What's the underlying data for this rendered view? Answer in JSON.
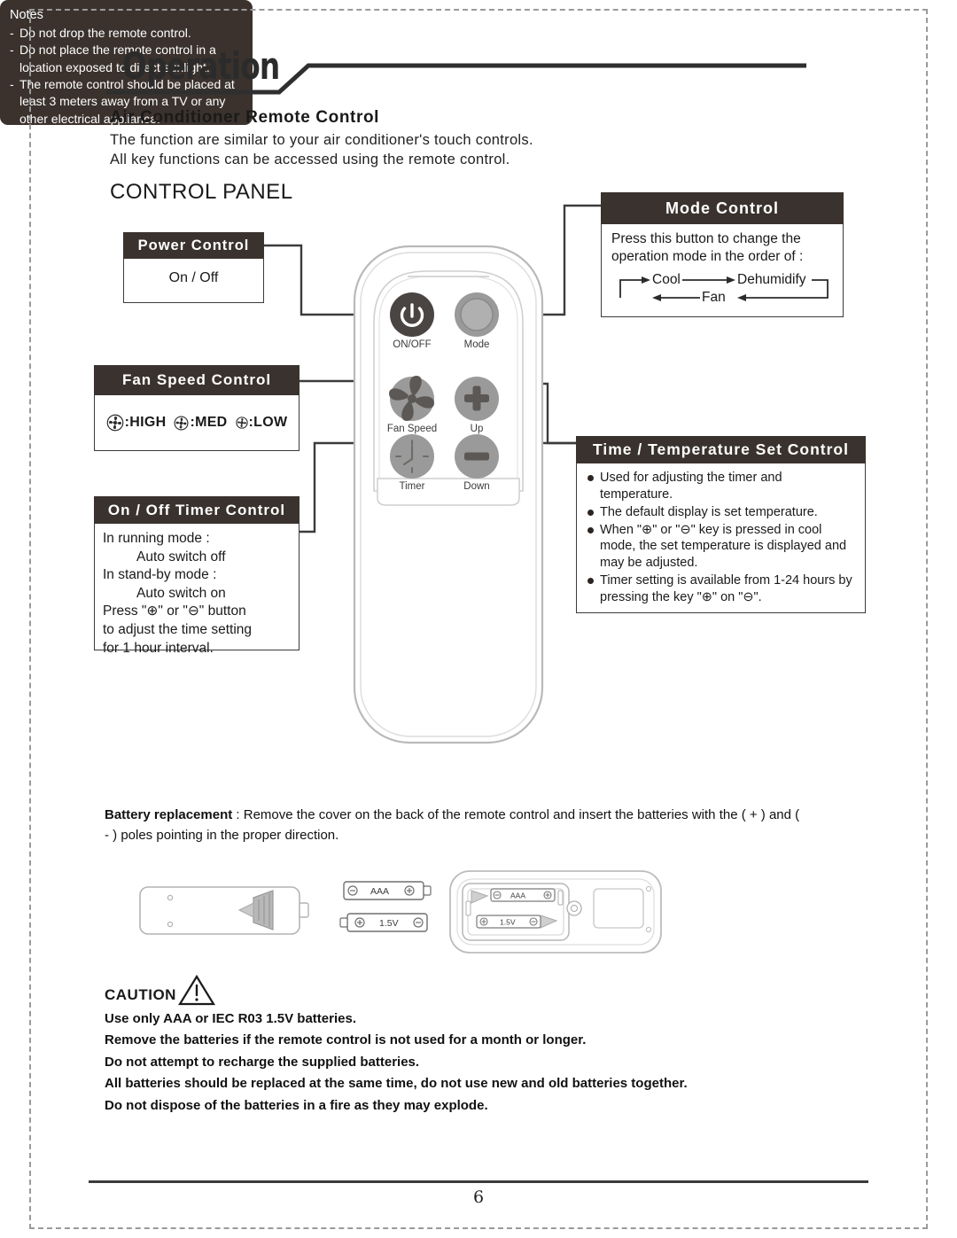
{
  "page": {
    "section_title": "Operation",
    "number": "6"
  },
  "intro": {
    "heading": "Air Conditioner Remote Control",
    "line1": "The function are similar to your air conditioner's touch controls.",
    "line2": "All key functions can be accessed using the remote control.",
    "panel_title": "CONTROL PANEL"
  },
  "callouts": {
    "power": {
      "title": "Power Control",
      "body": "On / Off"
    },
    "fan_speed": {
      "title": "Fan Speed Control",
      "options": [
        {
          "icon": "fan-icon-high",
          "label": ":HIGH"
        },
        {
          "icon": "fan-icon-med",
          "label": ":MED"
        },
        {
          "icon": "fan-icon-low",
          "label": ":LOW"
        }
      ]
    },
    "timer": {
      "title": "On / Off Timer Control",
      "lines": [
        "In running mode :",
        "Auto switch off",
        "In stand-by mode :",
        "Auto switch on",
        "Press \"⊕\" or \"⊖\" button",
        "to adjust the time setting",
        "for 1 hour interval."
      ]
    },
    "notes": {
      "title": "Notes",
      "items": [
        "Do not drop the remote control.",
        "Do not place the remote control in a location exposed to direct sunlight.",
        "The remote control should be placed at least 3 meters away from a TV or any other electrical appliance."
      ]
    },
    "mode": {
      "title": "Mode Control",
      "line1": "Press this button to change the",
      "line2": "operation mode in the order of :",
      "cycle": [
        "Cool",
        "Dehumidify",
        "Fan"
      ]
    },
    "time_temp": {
      "title": "Time / Temperature Set Control",
      "bullets": [
        "Used for adjusting the timer and temperature.",
        "The default display is set temperature.",
        "When \"⊕\" or \"⊖\" key is pressed in cool mode, the set temperature is displayed and may be adjusted.",
        "Timer setting is available from 1-24 hours by pressing the key \"⊕\" on \"⊖\"."
      ]
    }
  },
  "remote": {
    "buttons": [
      {
        "name": "on-off-button",
        "label": "ON/OFF",
        "icon": "power-icon"
      },
      {
        "name": "mode-button",
        "label": "Mode",
        "icon": "ring-icon"
      },
      {
        "name": "fan-speed-button",
        "label": "Fan Speed",
        "icon": "fan-icon"
      },
      {
        "name": "up-button",
        "label": "Up",
        "icon": "plus-icon"
      },
      {
        "name": "timer-button",
        "label": "Timer",
        "icon": "clock-icon"
      },
      {
        "name": "down-button",
        "label": "Down",
        "icon": "minus-icon"
      }
    ]
  },
  "battery": {
    "label": "Battery replacement",
    "text": " : Remove the cover on the back of the remote control and insert the batteries with the ( + ) and ( - ) poles pointing in the proper direction.",
    "cell_top_label": "AAA",
    "cell_bottom_label": "1.5V"
  },
  "caution": {
    "title": "CAUTION",
    "icon": "warning-triangle-icon",
    "lines": [
      "Use only AAA or IEC R03 1.5V batteries.",
      "Remove the batteries if the remote control is not used for a month or longer.",
      "Do not attempt to recharge the supplied batteries.",
      "All batteries should be replaced at the same time, do not use new and old batteries together.",
      "Do not dispose of the batteries in a fire as they may explode."
    ]
  },
  "colors": {
    "header_bar": "#3a322e",
    "notes_bg": "#3b322d",
    "rule": "#3b3b3b",
    "button_gray": "#9a9a9a",
    "button_dark": "#4a4442"
  }
}
